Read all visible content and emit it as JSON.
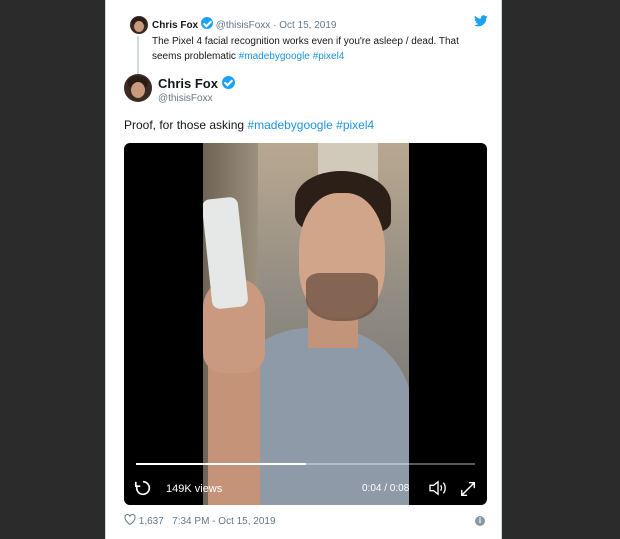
{
  "quoted_tweet": {
    "author_name": "Chris Fox",
    "author_handle": "@thisisFoxx",
    "separator": "·",
    "date": "Oct 15, 2019",
    "text": "The Pixel 4 facial recognition works even if you're asleep / dead. That seems problematic",
    "hashtags": [
      "#madebygoogle",
      "#pixel4"
    ]
  },
  "tweet": {
    "author_name": "Chris Fox",
    "author_handle": "@thisisFoxx",
    "text": "Proof, for those asking",
    "hashtags": [
      "#madebygoogle",
      "#pixel4"
    ]
  },
  "video": {
    "views_label": "149K views",
    "time_label": "0:04 / 0:08",
    "progress_fraction": 0.5
  },
  "footer": {
    "likes": "1,637",
    "timestamp": "7:34 PM - Oct 15, 2019"
  },
  "icons": {
    "bird": "twitter-bird-icon",
    "verified": "verified-badge-icon",
    "replay": "replay-icon",
    "volume": "volume-icon",
    "fullscreen": "fullscreen-icon",
    "heart": "heart-icon",
    "info": "info-icon"
  },
  "colors": {
    "link": "#1b95e0",
    "verified": "#1da1f2",
    "text": "#14171a",
    "muted": "#657786"
  }
}
